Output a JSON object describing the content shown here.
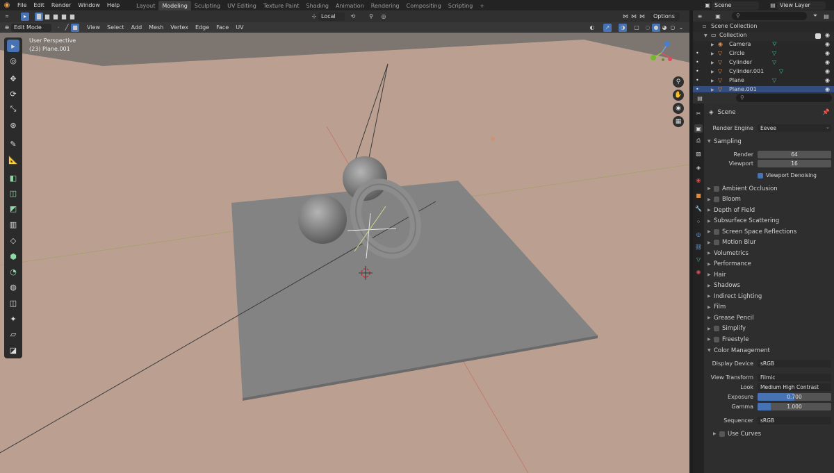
{
  "topbar": {
    "menus": [
      "File",
      "Edit",
      "Render",
      "Window",
      "Help"
    ],
    "workspaces": [
      "Layout",
      "Modeling",
      "Sculpting",
      "UV Editing",
      "Texture Paint",
      "Shading",
      "Animation",
      "Rendering",
      "Compositing",
      "Scripting"
    ],
    "active_workspace": "Modeling",
    "scene": "Scene",
    "view_layer": "View Layer"
  },
  "tool_header": {
    "transform_orientation": "Local",
    "options": "Options"
  },
  "viewport_header": {
    "mode": "Edit Mode",
    "menus": [
      "View",
      "Select",
      "Add",
      "Mesh",
      "Vertex",
      "Edge",
      "Face",
      "UV"
    ]
  },
  "viewport": {
    "perspective": "User Perspective",
    "object": "(23) Plane.001"
  },
  "outliner": {
    "scene_collection": "Scene Collection",
    "collection": "Collection",
    "items": [
      "Camera",
      "Circle",
      "Cylinder",
      "Cylinder.001",
      "Plane",
      "Plane.001"
    ]
  },
  "properties": {
    "context": "Scene",
    "render_engine_label": "Render Engine",
    "render_engine": "Eevee",
    "sampling": "Sampling",
    "render_label": "Render",
    "render_samples": "64",
    "viewport_label": "Viewport",
    "viewport_samples": "16",
    "viewport_denoising": "Viewport Denoising",
    "panels": [
      {
        "label": "Ambient Occlusion",
        "checkbox": true
      },
      {
        "label": "Bloom",
        "checkbox": true
      },
      {
        "label": "Depth of Field",
        "checkbox": false
      },
      {
        "label": "Subsurface Scattering",
        "checkbox": false
      },
      {
        "label": "Screen Space Reflections",
        "checkbox": true
      },
      {
        "label": "Motion Blur",
        "checkbox": true
      },
      {
        "label": "Volumetrics",
        "checkbox": false
      },
      {
        "label": "Performance",
        "checkbox": false
      },
      {
        "label": "Hair",
        "checkbox": false
      },
      {
        "label": "Shadows",
        "checkbox": false
      },
      {
        "label": "Indirect Lighting",
        "checkbox": false
      },
      {
        "label": "Film",
        "checkbox": false
      },
      {
        "label": "Grease Pencil",
        "checkbox": false
      },
      {
        "label": "Simplify",
        "checkbox": true
      },
      {
        "label": "Freestyle",
        "checkbox": true
      }
    ],
    "color_management": "Color Management",
    "display_device_label": "Display Device",
    "display_device": "sRGB",
    "view_transform_label": "View Transform",
    "view_transform": "Filmic",
    "look_label": "Look",
    "look": "Medium High Contrast",
    "exposure_label": "Exposure",
    "exposure": "0.700",
    "exposure_fill": 0.5,
    "gamma_label": "Gamma",
    "gamma": "1.000",
    "gamma_fill": 0.18,
    "sequencer_label": "Sequencer",
    "sequencer": "sRGB",
    "use_curves": "Use Curves"
  },
  "colors": {
    "accent": "#4772b3",
    "header": "#303030",
    "viewport_floor": "#bba092",
    "mesh_gray": "#838383"
  }
}
